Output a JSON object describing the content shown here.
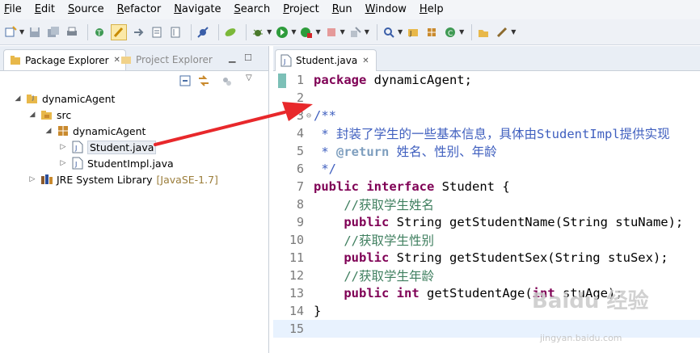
{
  "menubar": {
    "items": [
      "File",
      "Edit",
      "Source",
      "Refactor",
      "Navigate",
      "Search",
      "Project",
      "Run",
      "Window",
      "Help"
    ]
  },
  "toolbar": {
    "icons": [
      "new-icon",
      "save-icon",
      "save-all-icon",
      "print-icon",
      "open-type-icon",
      "toggle-mark-occurrences-icon",
      "next-annotation-icon",
      "previous-annotation-icon",
      "pin-editor-icon",
      "skip-breakpoints-icon",
      "spring-icon",
      "debug-icon",
      "run-icon",
      "coverage-icon",
      "stop-icon",
      "external-tools-icon",
      "search-icon",
      "new-java-project-icon",
      "new-package-icon",
      "new-class-icon",
      "open-task-icon",
      "open-perspective-icon"
    ]
  },
  "left_panel": {
    "tabs": [
      {
        "label": "Package Explorer",
        "active": true
      },
      {
        "label": "Project Explorer",
        "active": false
      }
    ],
    "tree": [
      {
        "label": "dynamicAgent",
        "icon": "project-icon",
        "expanded": true
      },
      {
        "label": "src",
        "icon": "source-folder-icon",
        "expanded": true
      },
      {
        "label": "dynamicAgent",
        "icon": "package-icon",
        "expanded": true
      },
      {
        "label": "Student.java",
        "icon": "java-file-icon",
        "selected": true
      },
      {
        "label": "StudentImpl.java",
        "icon": "java-file-icon"
      },
      {
        "label": "JRE System Library",
        "decoration": "[JavaSE-1.7]",
        "icon": "library-icon"
      }
    ]
  },
  "editor": {
    "tab_label": "Student.java",
    "lines": [
      {
        "n": "1",
        "tokens": [
          {
            "t": "package",
            "c": "kw"
          },
          {
            "t": " dynamicAgent;",
            "c": ""
          }
        ]
      },
      {
        "n": "2",
        "tokens": []
      },
      {
        "n": "3",
        "fold": true,
        "tokens": [
          {
            "t": "/**",
            "c": "cm"
          }
        ]
      },
      {
        "n": "4",
        "tokens": [
          {
            "t": " * 封装了学生的一些基本信息，具体由StudentImpl提供实现",
            "c": "cm"
          }
        ]
      },
      {
        "n": "5",
        "tokens": [
          {
            "t": " * ",
            "c": "cm"
          },
          {
            "t": "@return",
            "c": "ann"
          },
          {
            "t": " 姓名、性别、年龄",
            "c": "cm"
          }
        ]
      },
      {
        "n": "6",
        "tokens": [
          {
            "t": " */",
            "c": "cm"
          }
        ]
      },
      {
        "n": "7",
        "tokens": [
          {
            "t": "public",
            "c": "kw"
          },
          {
            "t": " ",
            "c": ""
          },
          {
            "t": "interface",
            "c": "kw"
          },
          {
            "t": " Student {",
            "c": ""
          }
        ]
      },
      {
        "n": "8",
        "tokens": [
          {
            "t": "    //获取学生姓名",
            "c": "lc"
          }
        ]
      },
      {
        "n": "9",
        "tokens": [
          {
            "t": "    ",
            "c": ""
          },
          {
            "t": "public",
            "c": "kw"
          },
          {
            "t": " String getStudentName(String stuName);",
            "c": ""
          }
        ]
      },
      {
        "n": "10",
        "tokens": [
          {
            "t": "    //获取学生性别",
            "c": "lc"
          }
        ]
      },
      {
        "n": "11",
        "tokens": [
          {
            "t": "    ",
            "c": ""
          },
          {
            "t": "public",
            "c": "kw"
          },
          {
            "t": " String getStudentSex(String stuSex);",
            "c": ""
          }
        ]
      },
      {
        "n": "12",
        "tokens": [
          {
            "t": "    //获取学生年龄",
            "c": "lc"
          }
        ]
      },
      {
        "n": "13",
        "tokens": [
          {
            "t": "    ",
            "c": ""
          },
          {
            "t": "public",
            "c": "kw"
          },
          {
            "t": " ",
            "c": ""
          },
          {
            "t": "int",
            "c": "kw"
          },
          {
            "t": " getStudentAge(",
            "c": ""
          },
          {
            "t": "int",
            "c": "kw"
          },
          {
            "t": " stuAge);",
            "c": ""
          }
        ]
      },
      {
        "n": "14",
        "tokens": [
          {
            "t": "}",
            "c": ""
          }
        ]
      },
      {
        "n": "15",
        "current": true,
        "tokens": []
      }
    ]
  },
  "watermark": {
    "text": "Baidu 经验",
    "url": "jingyan.baidu.com"
  },
  "colors": {
    "keyword": "#7f0055",
    "javadoc": "#3f5fbf",
    "comment": "#3f7f5f",
    "annotation_arrow": "#e8282b",
    "current_line": "#e8f2fe"
  }
}
